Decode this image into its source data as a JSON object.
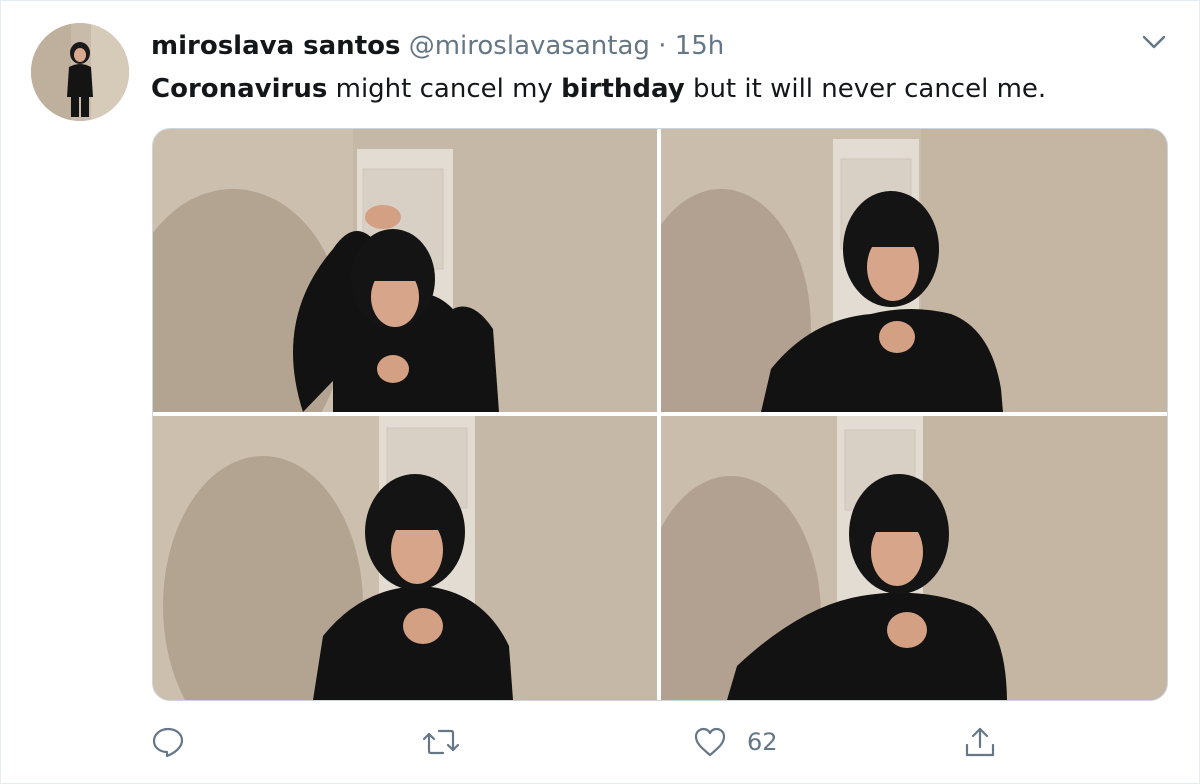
{
  "tweet": {
    "display_name": "miroslava santos",
    "handle": "@miroslavasantag",
    "separator": "·",
    "time": "15h",
    "text_parts": [
      {
        "text": "Coronavirus",
        "bold": true
      },
      {
        "text": " might cancel my ",
        "bold": false
      },
      {
        "text": "birthday",
        "bold": true
      },
      {
        "text": " but it will never cancel me.",
        "bold": false
      }
    ],
    "likes": "62"
  },
  "icons": {
    "menu": "chevron-down-icon",
    "reply": "reply-icon",
    "retweet": "retweet-icon",
    "like": "heart-icon",
    "share": "share-icon"
  },
  "colors": {
    "text": "#14171a",
    "muted": "#657786",
    "border": "#e6ecf0",
    "wall": "#cdbfae",
    "clothing": "#111111"
  }
}
